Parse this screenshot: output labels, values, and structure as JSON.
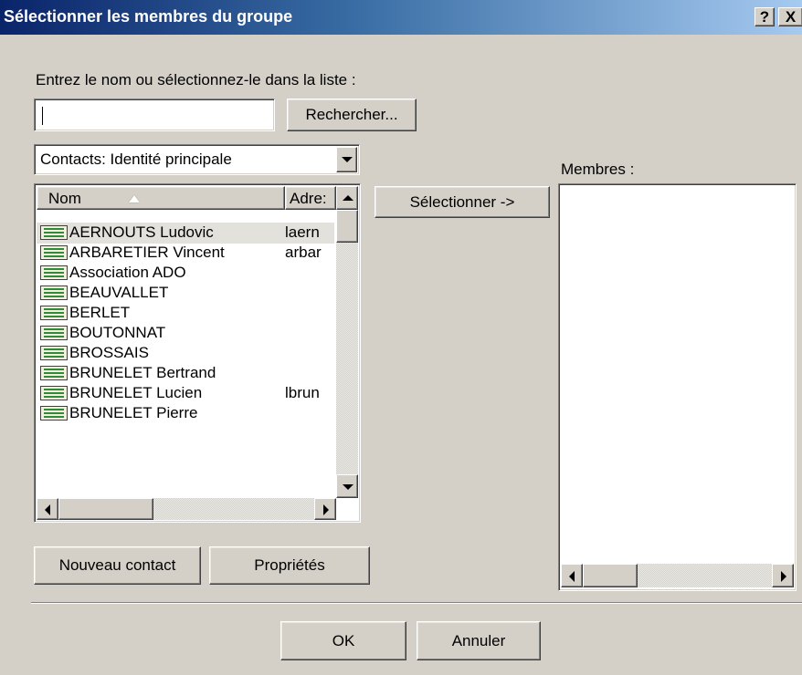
{
  "window": {
    "title": "Sélectionner les membres du groupe",
    "help_button": "?",
    "close_button": "X"
  },
  "search": {
    "prompt": "Entrez le nom ou sélectionnez-le dans la liste :",
    "value": "",
    "button_label": "Rechercher..."
  },
  "address_book": {
    "selected": "Contacts: Identité principale"
  },
  "contacts_list": {
    "columns": [
      "Nom",
      "Adre:"
    ],
    "rows": [
      {
        "name": "AERNOUTS Ludovic",
        "address": "laern"
      },
      {
        "name": "ARBARETIER Vincent",
        "address": "arbar"
      },
      {
        "name": "Association ADO",
        "address": ""
      },
      {
        "name": "BEAUVALLET",
        "address": ""
      },
      {
        "name": "BERLET",
        "address": ""
      },
      {
        "name": "BOUTONNAT",
        "address": ""
      },
      {
        "name": "BROSSAIS",
        "address": ""
      },
      {
        "name": "BRUNELET Bertrand",
        "address": ""
      },
      {
        "name": "BRUNELET Lucien",
        "address": "lbrun"
      },
      {
        "name": "BRUNELET Pierre",
        "address": ""
      }
    ],
    "icon": "contact-card-icon"
  },
  "select_button": "Sélectionner ->",
  "members": {
    "label": "Membres :"
  },
  "buttons": {
    "new_contact": "Nouveau contact",
    "properties": "Propriétés",
    "ok": "OK",
    "cancel": "Annuler"
  },
  "colors": {
    "title_bar_start": "#0a246a",
    "title_bar_end": "#a6caf0",
    "dialog_face": "#d4d0c8",
    "contact_icon_green": "#2f8a39"
  }
}
